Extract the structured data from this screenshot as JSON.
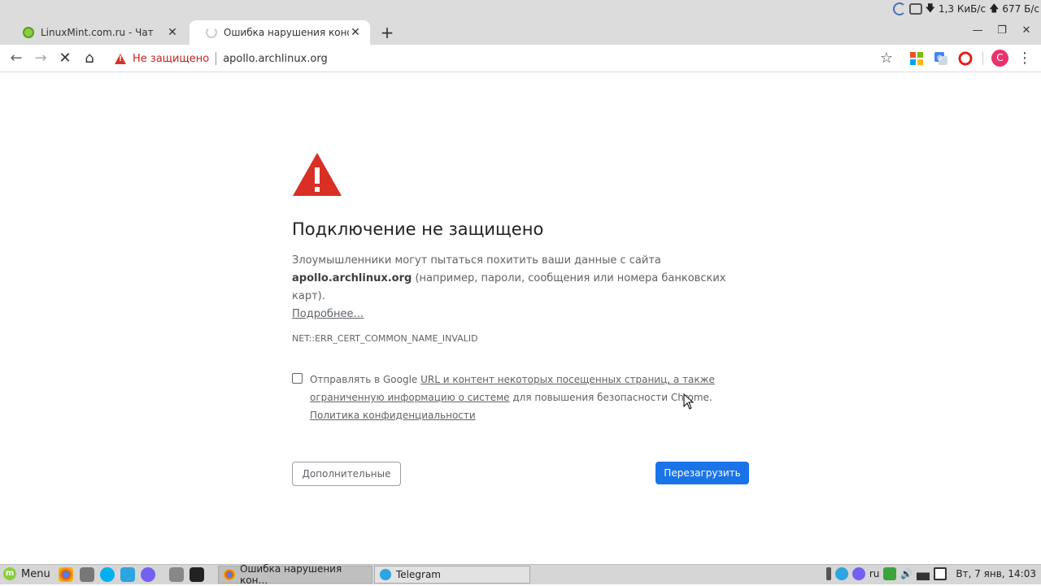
{
  "system": {
    "download_speed": "1,3 КиБ/с",
    "upload_speed": "677 Б/с"
  },
  "tabs": [
    {
      "title": "LinuxMint.com.ru - Чат",
      "close": "✕"
    },
    {
      "title": "Ошибка нарушения конфид",
      "close": "✕"
    }
  ],
  "tabstrip": {
    "new_tab": "+",
    "minimize": "—",
    "restore": "❐",
    "close": "✕"
  },
  "toolbar": {
    "back": "←",
    "forward": "→",
    "stop": "✕",
    "home": "⌂",
    "security_label": "Не защищено",
    "url": "apollo.archlinux.org",
    "bookmark": "☆",
    "profile_initial": "C",
    "menu": "⋮"
  },
  "interstitial": {
    "heading": "Подключение не защищено",
    "paragraph_part1": "Злоумышленники могут пытаться похитить ваши данные с сайта ",
    "paragraph_domain": "apollo.archlinux.org",
    "paragraph_part2": " (например, пароли, сообщения или номера банковских карт).",
    "learn_more": "Подробнее…",
    "error_code": "NET::ERR_CERT_COMMON_NAME_INVALID",
    "optin_prefix": "Отправлять в Google ",
    "optin_link1": "URL и контент некоторых посещенных страниц, а также ограниченную информацию о системе",
    "optin_middle": " для повышения безопасности Chrome. ",
    "optin_link2": "Политика конфиденциальности",
    "advanced_button": "Дополнительные",
    "reload_button": "Перезагрузить"
  },
  "taskbar": {
    "menu_label": "Menu",
    "menu_logo": "m",
    "tasks": [
      {
        "label": "Ошибка нарушения кон…"
      },
      {
        "label": "Telegram"
      }
    ],
    "layout": "ru",
    "clock": "Вт, 7 янв, 14:03"
  },
  "colors": {
    "accent": "#1a73e8",
    "danger": "#d93025"
  }
}
